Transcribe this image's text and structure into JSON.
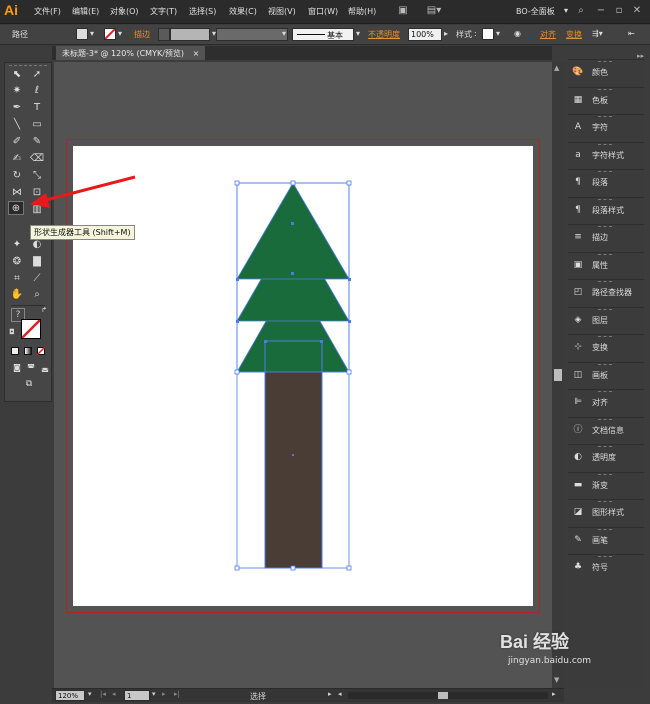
{
  "app": {
    "logo": "Ai"
  },
  "menu": [
    "文件(F)",
    "编辑(E)",
    "对象(O)",
    "文字(T)",
    "选择(S)",
    "效果(C)",
    "视图(V)",
    "窗口(W)",
    "帮助(H)"
  ],
  "workspace": "BO-全面板",
  "control": {
    "path_label": "路径",
    "stroke_label": "描边",
    "stroke_style": "基本",
    "opacity_label": "不透明度",
    "opacity_value": "100%",
    "style_label": "样式",
    "align_label": "对齐",
    "transform_label": "变换"
  },
  "document_tab": {
    "title": "未标题-3* @ 120% (CMYK/预览)",
    "close": "×"
  },
  "tooltip": "形状生成器工具 (Shift+M)",
  "panels": [
    {
      "icon": "palette-icon",
      "glyph": "🎨",
      "label": "颜色"
    },
    {
      "icon": "swatches-icon",
      "glyph": "▦",
      "label": "色板"
    },
    {
      "icon": "character-icon",
      "glyph": "A",
      "label": "字符"
    },
    {
      "icon": "character-style-icon",
      "glyph": "a",
      "label": "字符样式"
    },
    {
      "icon": "paragraph-icon",
      "glyph": "¶",
      "label": "段落"
    },
    {
      "icon": "paragraph-style-icon",
      "glyph": "¶",
      "label": "段落样式"
    },
    {
      "icon": "stroke-icon",
      "glyph": "≡",
      "label": "描边"
    },
    {
      "icon": "attributes-icon",
      "glyph": "▣",
      "label": "属性"
    },
    {
      "icon": "pathfinder-icon",
      "glyph": "◰",
      "label": "路径查找器"
    },
    {
      "icon": "layers-icon",
      "glyph": "◈",
      "label": "图层"
    },
    {
      "icon": "transform-icon",
      "glyph": "⊹",
      "label": "变换"
    },
    {
      "icon": "artboard-icon",
      "glyph": "◫",
      "label": "画板"
    },
    {
      "icon": "align-icon",
      "glyph": "⊫",
      "label": "对齐"
    },
    {
      "icon": "doc-info-icon",
      "glyph": "ⓘ",
      "label": "文档信息"
    },
    {
      "icon": "transparency-icon",
      "glyph": "◐",
      "label": "透明度"
    },
    {
      "icon": "gradient-icon",
      "glyph": "▬",
      "label": "渐变"
    },
    {
      "icon": "graphic-style-icon",
      "glyph": "◪",
      "label": "图形样式"
    },
    {
      "icon": "brush-icon",
      "glyph": "✎",
      "label": "画笔"
    },
    {
      "icon": "symbol-icon",
      "glyph": "♣",
      "label": "符号"
    }
  ],
  "status": {
    "zoom": "120%",
    "artboard_num": "1",
    "mode": "选择"
  },
  "colors": {
    "tree_green": "#1a6b3c",
    "trunk_brown": "#4a3d36",
    "selection_blue": "#4a7ce8",
    "bleed_red": "#b52222",
    "accent_orange": "#ff9a00"
  },
  "watermark": {
    "brand": "Bai 经验",
    "url": "jingyan.baidu.com"
  }
}
